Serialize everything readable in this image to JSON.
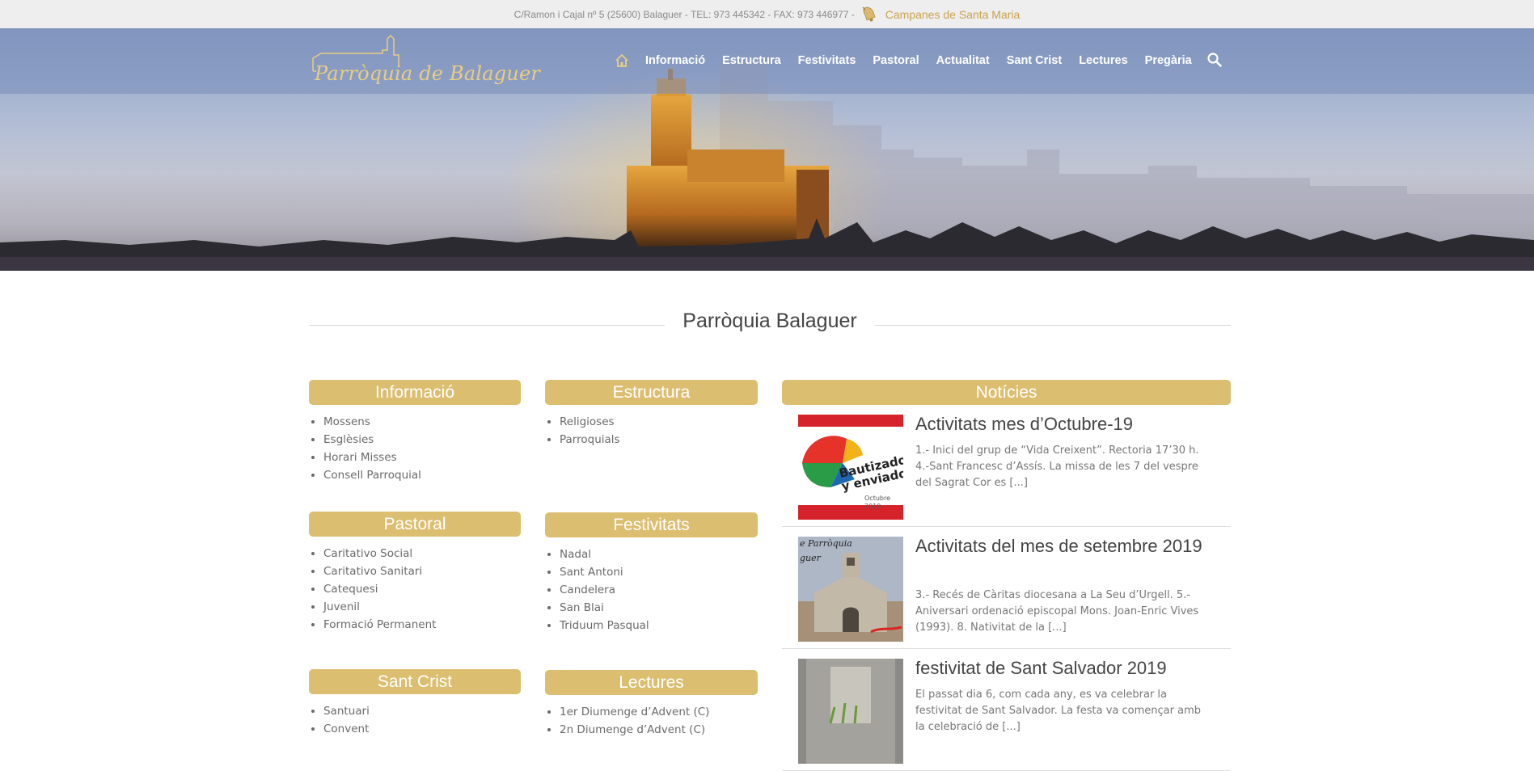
{
  "topbar": {
    "address": "C/Ramon i Cajal nº 5 (25600) Balaguer - TEL: 973 445342 - FAX: 973 446977 -",
    "bells_link": "Campanes de Santa Maria",
    "bell_icon": "bell-icon"
  },
  "header": {
    "logo_text": "Parròquia de Balaguer",
    "nav": [
      "Informació",
      "Estructura",
      "Festivitats",
      "Pastoral",
      "Actualitat",
      "Sant Crist",
      "Lectures",
      "Pregària"
    ],
    "home_icon": "home-icon",
    "search_icon": "search-icon"
  },
  "main": {
    "title": "Parròquia Balaguer"
  },
  "widgets": {
    "informacio": {
      "title": "Informació",
      "items": [
        "Mossens",
        "Esglèsies",
        "Horari Misses",
        "Consell Parroquial"
      ]
    },
    "estructura": {
      "title": "Estructura",
      "items": [
        "Religioses",
        "Parroquials"
      ]
    },
    "pastoral": {
      "title": "Pastoral",
      "items": [
        "Caritativo Social",
        "Caritativo Sanitari",
        "Catequesi",
        "Juvenil",
        "Formació Permanent"
      ]
    },
    "festivitats": {
      "title": "Festivitats",
      "items": [
        "Nadal",
        "Sant Antoni",
        "Candelera",
        "San Blai",
        "Triduum Pasqual"
      ]
    },
    "sant_crist": {
      "title": "Sant Crist",
      "items": [
        "Santuari",
        "Convent"
      ]
    },
    "lectures": {
      "title": "Lectures",
      "items": [
        "1er Diumenge d’Advent (C)",
        "2n Diumenge d’Advent (C)"
      ]
    }
  },
  "news": {
    "title": "Notícies",
    "items": [
      {
        "title": "Activitats mes d’Octubre-19",
        "excerpt": "1.- Inici  del grup de “Vida Creixent”. Rectoria 17’30 h. 4.-Sant Francesc d’Assís. La missa de les 7 del vespre del Sagrat Cor es [...]",
        "thumb_text_1": "Bautizados",
        "thumb_text_2": "y enviados",
        "thumb_text_3": "Octubre",
        "thumb_text_4": "2019"
      },
      {
        "title": "Activitats del mes de setembre 2019",
        "excerpt": "3.- Recés de Càritas diocesana a La Seu d’Urgell. 5.- Aniversari ordenació episcopal Mons. Joan-Enric Vives (1993). 8. Nativitat de la [...]",
        "thumb_text_1": "e Parròquia",
        "thumb_text_2": "guer"
      },
      {
        "title": "festivitat de Sant Salvador 2019",
        "excerpt": "El passat dia 6, com cada any, es va celebrar la festivitat de Sant Salvador. La festa va començar amb la celebració de [...]"
      }
    ]
  }
}
